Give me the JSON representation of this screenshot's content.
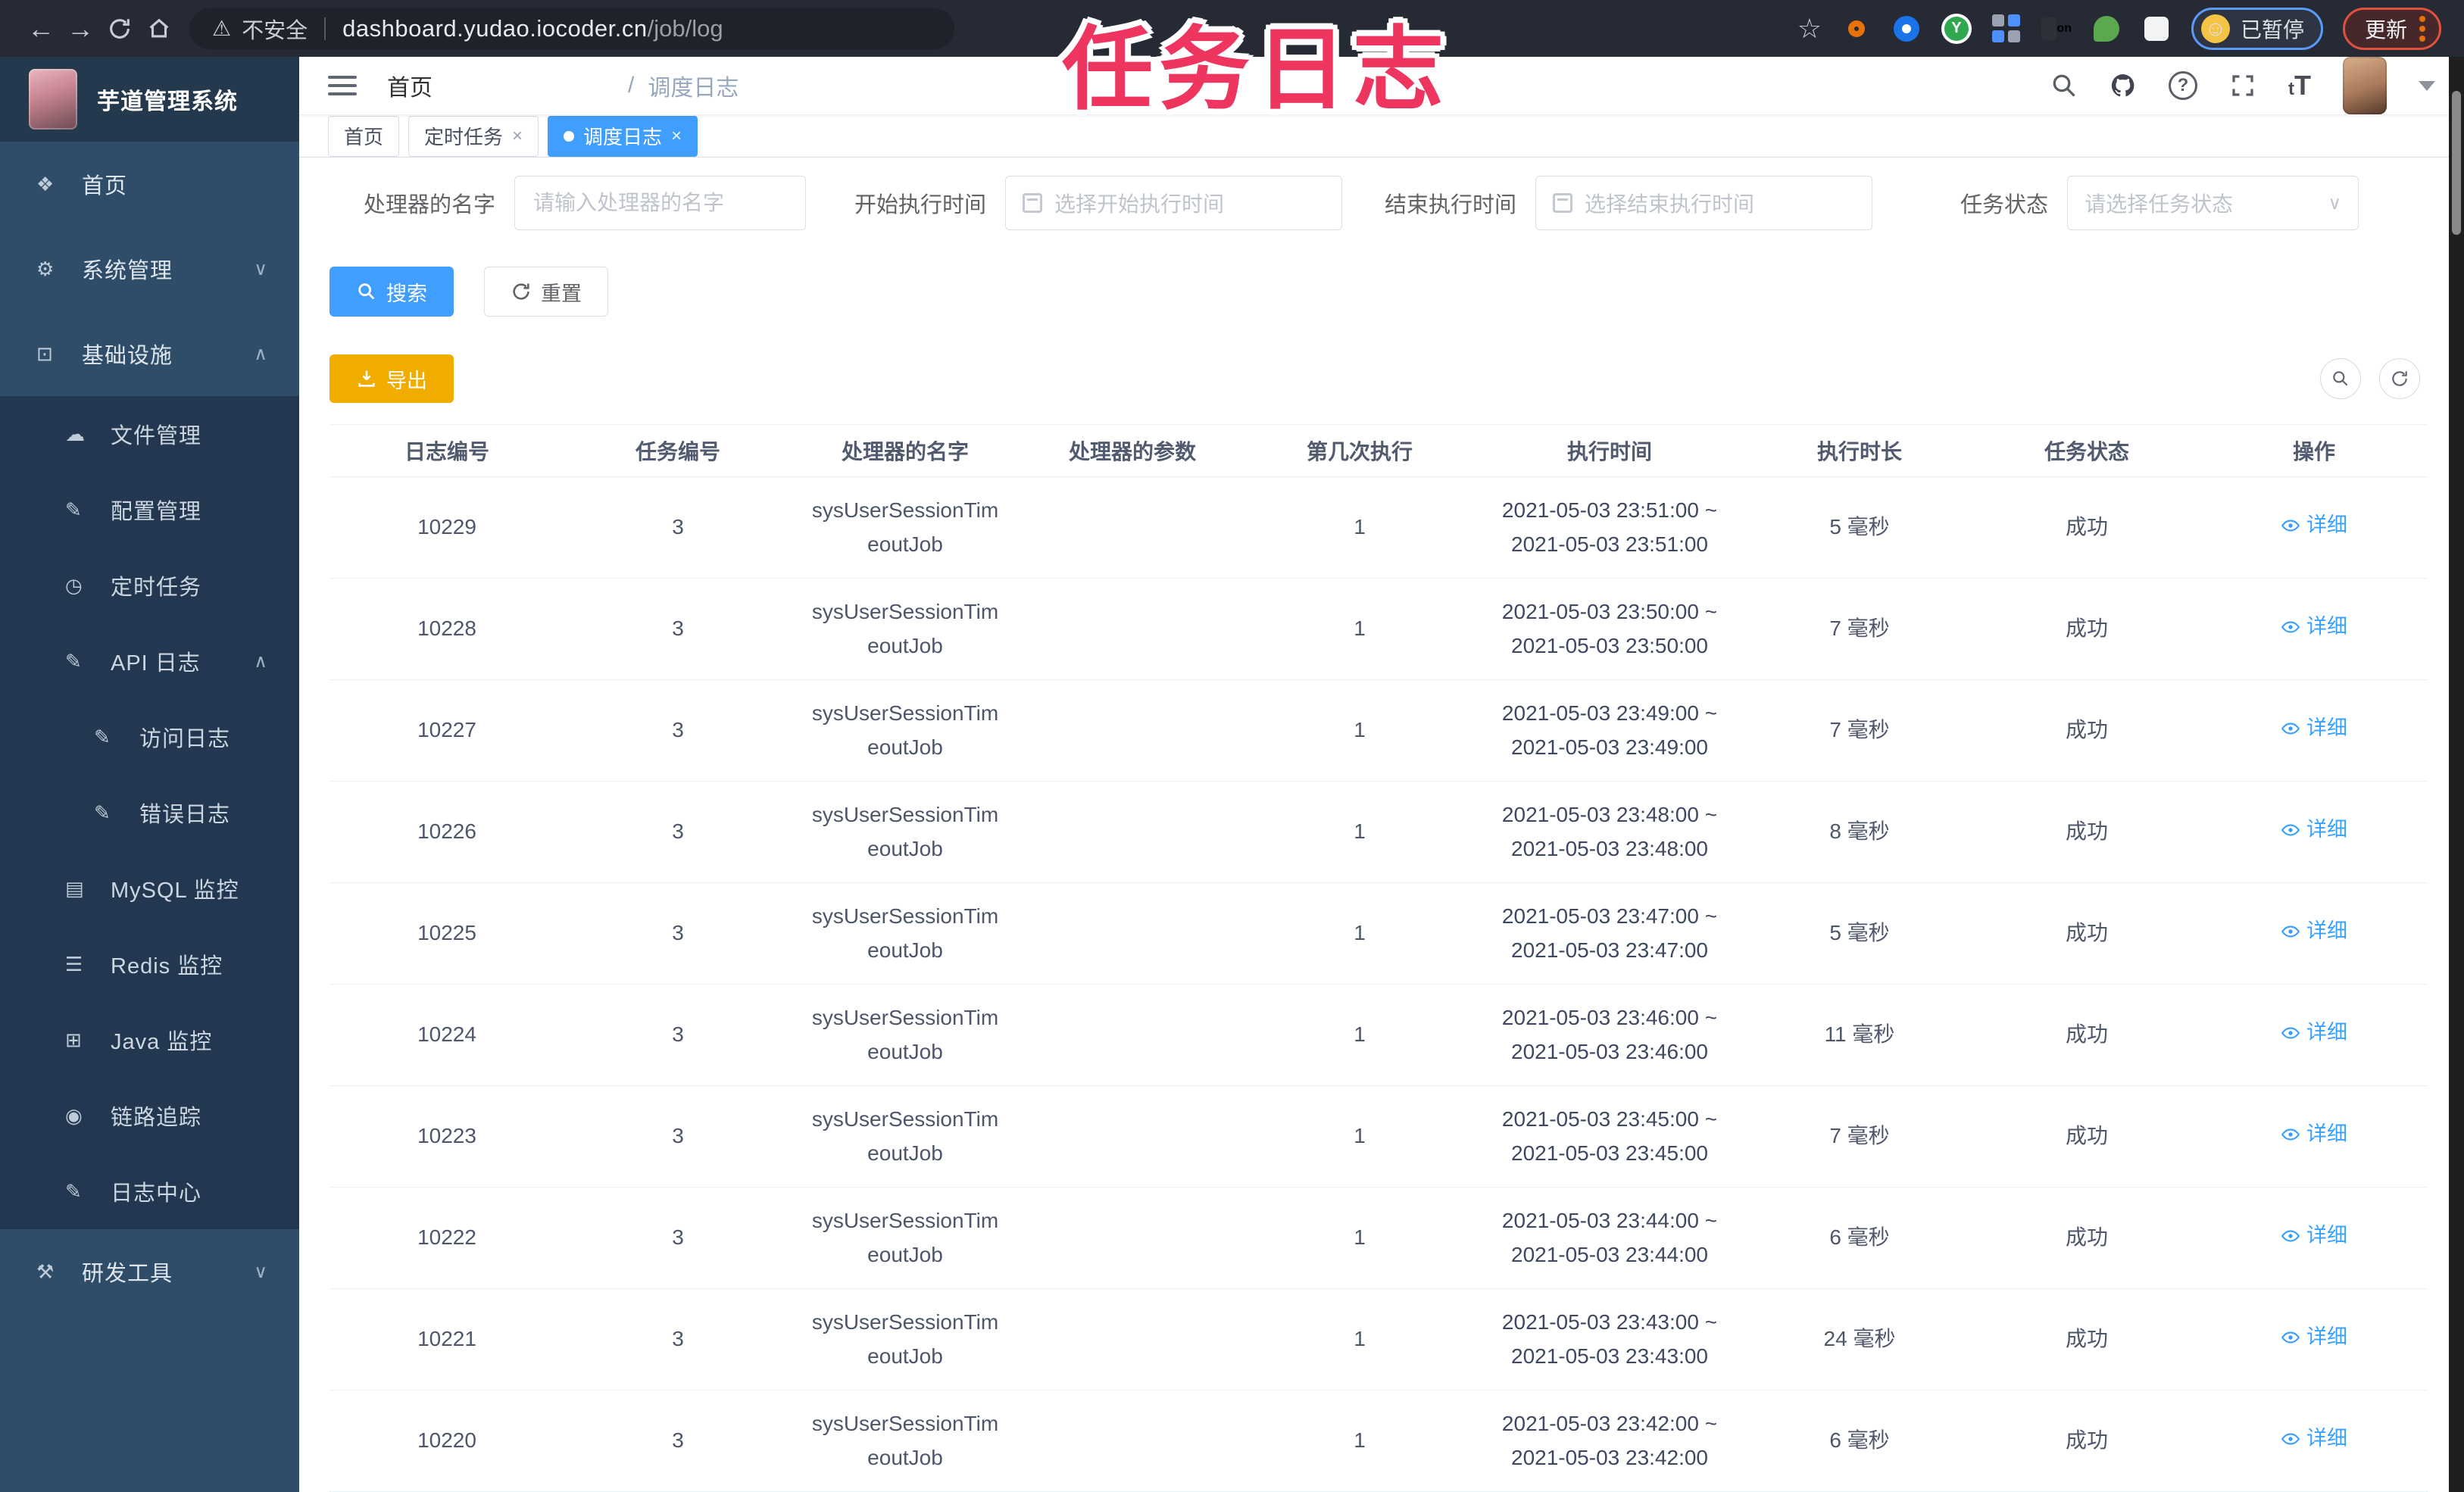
{
  "browser": {
    "security_label": "不安全",
    "url_host": "dashboard.yudao.iocoder.cn",
    "url_path": "/job/log",
    "extension_badge": "on",
    "extension_y_letter": "Y",
    "paused_chip": "已暂停",
    "update_button": "更新"
  },
  "overlay": {
    "title": "任务日志",
    "color": "#ee3560"
  },
  "sidebar": {
    "logo_title": "芋道管理系统",
    "items": [
      {
        "id": "home",
        "label": "首页",
        "icon": "❖",
        "level": 1,
        "chevron": ""
      },
      {
        "id": "system-management",
        "label": "系统管理",
        "icon": "⚙",
        "level": 1,
        "chevron": "down"
      },
      {
        "id": "infrastructure",
        "label": "基础设施",
        "icon": "⊡",
        "level": 1,
        "chevron": "up"
      },
      {
        "id": "file-management",
        "label": "文件管理",
        "icon": "☁",
        "level": 2,
        "chevron": ""
      },
      {
        "id": "config-management",
        "label": "配置管理",
        "icon": "✎",
        "level": 2,
        "chevron": ""
      },
      {
        "id": "scheduled-tasks",
        "label": "定时任务",
        "icon": "◷",
        "level": 2,
        "chevron": ""
      },
      {
        "id": "api-log",
        "label": "API 日志",
        "icon": "✎",
        "level": 2,
        "chevron": "up"
      },
      {
        "id": "access-log",
        "label": "访问日志",
        "icon": "✎",
        "level": 3,
        "chevron": ""
      },
      {
        "id": "error-log",
        "label": "错误日志",
        "icon": "✎",
        "level": 3,
        "chevron": ""
      },
      {
        "id": "mysql-monitor",
        "label": "MySQL 监控",
        "icon": "▤",
        "level": 2,
        "chevron": ""
      },
      {
        "id": "redis-monitor",
        "label": "Redis 监控",
        "icon": "☰",
        "level": 2,
        "chevron": ""
      },
      {
        "id": "java-monitor",
        "label": "Java 监控",
        "icon": "⊞",
        "level": 2,
        "chevron": ""
      },
      {
        "id": "trace",
        "label": "链路追踪",
        "icon": "◉",
        "level": 2,
        "chevron": ""
      },
      {
        "id": "log-center",
        "label": "日志中心",
        "icon": "✎",
        "level": 2,
        "chevron": ""
      },
      {
        "id": "dev-tools",
        "label": "研发工具",
        "icon": "⚒",
        "level": 1,
        "chevron": "down"
      }
    ]
  },
  "header": {
    "breadcrumb_home": "首页",
    "breadcrumb_sep": "/",
    "breadcrumb_current": "调度日志",
    "text_size_small": "t",
    "text_size_big": "T"
  },
  "tabs": [
    {
      "label": "首页"
    },
    {
      "label": "定时任务"
    },
    {
      "label": "调度日志"
    }
  ],
  "filters": {
    "handler_name": {
      "label": "处理器的名字",
      "placeholder": "请输入处理器的名字"
    },
    "start_time": {
      "label": "开始执行时间",
      "placeholder": "选择开始执行时间"
    },
    "end_time": {
      "label": "结束执行时间",
      "placeholder": "选择结束执行时间"
    },
    "status": {
      "label": "任务状态",
      "placeholder": "请选择任务状态"
    }
  },
  "actions": {
    "search": "搜索",
    "reset": "重置",
    "export": "导出"
  },
  "table": {
    "columns": [
      "日志编号",
      "任务编号",
      "处理器的名字",
      "处理器的参数",
      "第几次执行",
      "执行时间",
      "执行时长",
      "任务状态",
      "操作"
    ],
    "action_label": "详细",
    "rows": [
      {
        "log_id": "10229",
        "task_id": "3",
        "handler_line1": "sysUserSessionTim",
        "handler_line2": "eoutJob",
        "param": "",
        "execute_index": "1",
        "time_start": "2021-05-03 23:51:00 ~",
        "time_end": "2021-05-03 23:51:00",
        "duration": "5 毫秒",
        "status": "成功"
      },
      {
        "log_id": "10228",
        "task_id": "3",
        "handler_line1": "sysUserSessionTim",
        "handler_line2": "eoutJob",
        "param": "",
        "execute_index": "1",
        "time_start": "2021-05-03 23:50:00 ~",
        "time_end": "2021-05-03 23:50:00",
        "duration": "7 毫秒",
        "status": "成功"
      },
      {
        "log_id": "10227",
        "task_id": "3",
        "handler_line1": "sysUserSessionTim",
        "handler_line2": "eoutJob",
        "param": "",
        "execute_index": "1",
        "time_start": "2021-05-03 23:49:00 ~",
        "time_end": "2021-05-03 23:49:00",
        "duration": "7 毫秒",
        "status": "成功"
      },
      {
        "log_id": "10226",
        "task_id": "3",
        "handler_line1": "sysUserSessionTim",
        "handler_line2": "eoutJob",
        "param": "",
        "execute_index": "1",
        "time_start": "2021-05-03 23:48:00 ~",
        "time_end": "2021-05-03 23:48:00",
        "duration": "8 毫秒",
        "status": "成功"
      },
      {
        "log_id": "10225",
        "task_id": "3",
        "handler_line1": "sysUserSessionTim",
        "handler_line2": "eoutJob",
        "param": "",
        "execute_index": "1",
        "time_start": "2021-05-03 23:47:00 ~",
        "time_end": "2021-05-03 23:47:00",
        "duration": "5 毫秒",
        "status": "成功"
      },
      {
        "log_id": "10224",
        "task_id": "3",
        "handler_line1": "sysUserSessionTim",
        "handler_line2": "eoutJob",
        "param": "",
        "execute_index": "1",
        "time_start": "2021-05-03 23:46:00 ~",
        "time_end": "2021-05-03 23:46:00",
        "duration": "11 毫秒",
        "status": "成功"
      },
      {
        "log_id": "10223",
        "task_id": "3",
        "handler_line1": "sysUserSessionTim",
        "handler_line2": "eoutJob",
        "param": "",
        "execute_index": "1",
        "time_start": "2021-05-03 23:45:00 ~",
        "time_end": "2021-05-03 23:45:00",
        "duration": "7 毫秒",
        "status": "成功"
      },
      {
        "log_id": "10222",
        "task_id": "3",
        "handler_line1": "sysUserSessionTim",
        "handler_line2": "eoutJob",
        "param": "",
        "execute_index": "1",
        "time_start": "2021-05-03 23:44:00 ~",
        "time_end": "2021-05-03 23:44:00",
        "duration": "6 毫秒",
        "status": "成功"
      },
      {
        "log_id": "10221",
        "task_id": "3",
        "handler_line1": "sysUserSessionTim",
        "handler_line2": "eoutJob",
        "param": "",
        "execute_index": "1",
        "time_start": "2021-05-03 23:43:00 ~",
        "time_end": "2021-05-03 23:43:00",
        "duration": "24 毫秒",
        "status": "成功"
      },
      {
        "log_id": "10220",
        "task_id": "3",
        "handler_line1": "sysUserSessionTim",
        "handler_line2": "eoutJob",
        "param": "",
        "execute_index": "1",
        "time_start": "2021-05-03 23:42:00 ~",
        "time_end": "2021-05-03 23:42:00",
        "duration": "6 毫秒",
        "status": "成功"
      }
    ]
  }
}
